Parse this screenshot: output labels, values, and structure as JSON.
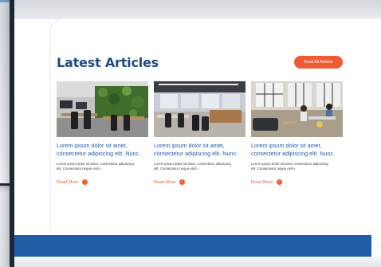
{
  "section": {
    "title": "Latest Articles",
    "read_all_label": "Read All Articles"
  },
  "articles": [
    {
      "title": "Lorem ipsum dolor sit amet, consectetur adipiscing elit. Nunc.",
      "excerpt": "Lorem ipsum dolor sit amet, consectetur adipiscing elit. Consectetur neque enim.",
      "more_label": "Read More",
      "image": "office-with-plant-wall"
    },
    {
      "title": "Lorem ipsum dolor sit amet, consectetur adipiscing elit. Nunc.",
      "excerpt": "Lorem ipsum dolor sit amet, consectetur adipiscing elit. Consectetur neque enim.",
      "more_label": "Read More",
      "image": "open-office-desks"
    },
    {
      "title": "Lorem ipsum dolor sit amet, consectetur adipiscing elit. Nunc.",
      "excerpt": "Lorem ipsum dolor sit amet, consectetur adipiscing elit. Consectetur neque enim.",
      "more_label": "Read More",
      "image": "lounge-with-sofa"
    }
  ],
  "colors": {
    "title": "#1e4d84",
    "link": "#1f5ea8",
    "accent": "#ec5b33",
    "footer": "#1d5ea6"
  }
}
